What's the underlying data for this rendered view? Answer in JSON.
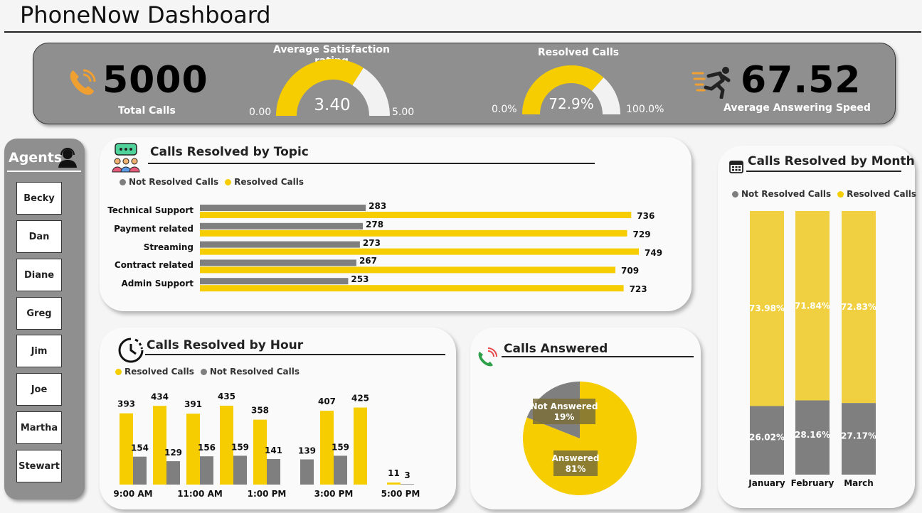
{
  "dashboard_title": "PhoneNow Dashboard",
  "colors": {
    "resolved": "#f5cd00",
    "not_resolved": "#7f7f7f",
    "panel_bg": "#8f8f8f",
    "accent_orange": "#f0a030"
  },
  "kpi": {
    "total_calls": {
      "value": "5000",
      "label": "Total Calls",
      "icon": "phone-icon"
    },
    "satisfaction": {
      "title": "Average Satisfaction rating",
      "value": "3.40",
      "min": "0.00",
      "max": "5.00",
      "fraction": 0.68
    },
    "resolved": {
      "title": "Resolved Calls",
      "value": "72.9%",
      "min": "0.0%",
      "max": "100.0%",
      "fraction": 0.729
    },
    "answering_speed": {
      "value": "67.52",
      "label": "Average Answering Speed",
      "icon": "running-man-icon"
    }
  },
  "agents": {
    "title": "Agents",
    "items": [
      "Becky",
      "Dan",
      "Diane",
      "Greg",
      "Jim",
      "Joe",
      "Martha",
      "Stewart"
    ]
  },
  "chart_data": [
    {
      "type": "bar",
      "orientation": "horizontal",
      "title": "Calls Resolved by Topic",
      "legend": [
        "Not Resolved Calls",
        "Resolved Calls"
      ],
      "categories": [
        "Technical Support",
        "Payment related",
        "Streaming",
        "Contract related",
        "Admin Support"
      ],
      "series": [
        {
          "name": "Not Resolved Calls",
          "values": [
            283,
            278,
            273,
            267,
            253
          ]
        },
        {
          "name": "Resolved Calls",
          "values": [
            736,
            729,
            749,
            709,
            723
          ]
        }
      ]
    },
    {
      "type": "bar",
      "title": "Calls Resolved by Hour",
      "legend": [
        "Resolved Calls",
        "Not Resolved Calls"
      ],
      "x_tick_labels": [
        "9:00 AM",
        "11:00 AM",
        "1:00 PM",
        "3:00 PM",
        "5:00 PM"
      ],
      "series": [
        {
          "name": "Resolved Calls",
          "values": [
            393,
            434,
            391,
            435,
            358,
            0,
            407,
            425,
            11
          ]
        },
        {
          "name": "Not Resolved Calls",
          "values": [
            154,
            129,
            156,
            159,
            141,
            139,
            159,
            0,
            3
          ]
        }
      ]
    },
    {
      "type": "pie",
      "title": "Calls Answered",
      "slices": [
        {
          "label": "Answered",
          "value": 81,
          "display": "81%"
        },
        {
          "label": "Not Answered",
          "value": 19,
          "display": "19%"
        }
      ]
    },
    {
      "type": "bar",
      "stacked": true,
      "title": "Calls Resolved by Month",
      "legend": [
        "Not Resolved Calls",
        "Resolved Calls"
      ],
      "categories": [
        "January",
        "February",
        "March"
      ],
      "series": [
        {
          "name": "Resolved Calls",
          "values": [
            73.98,
            71.84,
            72.83
          ],
          "labels": [
            "73.98%",
            "71.84%",
            "72.83%"
          ]
        },
        {
          "name": "Not Resolved Calls",
          "values": [
            26.02,
            28.16,
            27.17
          ],
          "labels": [
            "26.02%",
            "28.16%",
            "27.17%"
          ]
        }
      ]
    }
  ]
}
